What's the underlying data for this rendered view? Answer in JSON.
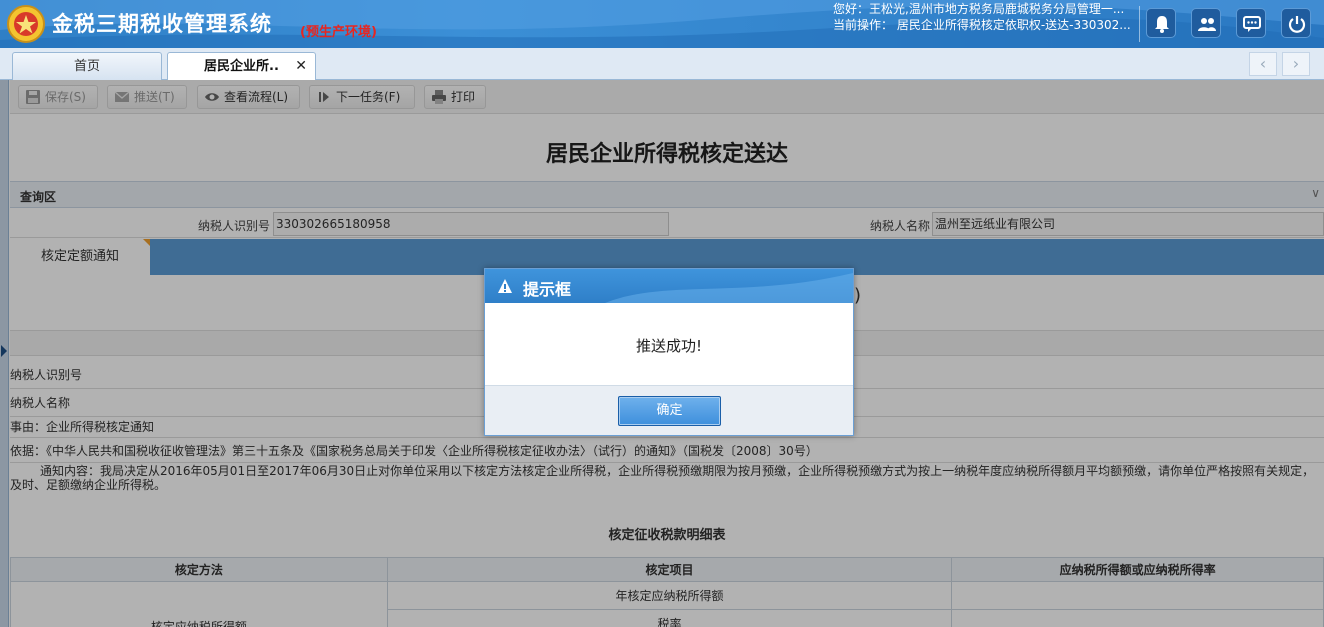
{
  "header": {
    "system_title": "金税三期税收管理系统",
    "environment": "(预生产环境)",
    "greeting": "您好：王松光,温州市地方税务局鹿城税务分局管理一...",
    "current_op": "当前操作： 居民企业所得税核定依职权-送达-330302..."
  },
  "tabs": {
    "home": "首页",
    "active": "居民企业所..",
    "close_symbol": "✕"
  },
  "toolbar": {
    "save": "保存(S)",
    "push": "推送(T)",
    "view_flow": "查看流程(L)",
    "next_task": "下一任务(F)",
    "print": "打印"
  },
  "form": {
    "title": "居民企业所得税核定送达",
    "query_section": "查询区",
    "taxpayer_id_label": "纳税人识别号",
    "taxpayer_id_value": "330302665180958",
    "taxpayer_name_label": "纳税人名称",
    "taxpayer_name_value": "温州至远纸业有限公司",
    "subtab": "核定定额通知"
  },
  "detail": {
    "open_paren": "(",
    "close_paren": ")",
    "row_taxpayer_id": "纳税人识别号",
    "row_taxpayer_name": "纳税人名称",
    "row_reason": "事由：企业所得税核定通知",
    "row_basis": "依据：《中华人民共和国税收征收管理法》第三十五条及《国家税务总局关于印发〈企业所得税核定征收办法〉（试行）的通知》（国税发〔2008〕30号）",
    "notice": "通知内容：我局决定从2016年05月01日至2017年06月30日止对你单位采用以下核定方法核定企业所得税，企业所得税预缴期限为按月预缴，企业所得税预缴方式为按上一纳税年度应纳税所得额月平均额预缴，请你单位严格按照有关规定，及时、足额缴纳企业所得税。",
    "table_title": "核定征收税款明细表",
    "col_method": "核定方法",
    "col_item": "核定项目",
    "col_rate": "应纳税所得额或应纳税所得率",
    "item1": "年核定应纳税所得额",
    "method1": "核定应纳税所得额",
    "item2": "税率"
  },
  "dialog": {
    "title": "提示框",
    "message": "推送成功!",
    "ok": "确定"
  },
  "colors": {
    "header_blue": "#2f7fc6",
    "subtab_blue": "#5b9bd5",
    "env_red": "#e8251f"
  }
}
